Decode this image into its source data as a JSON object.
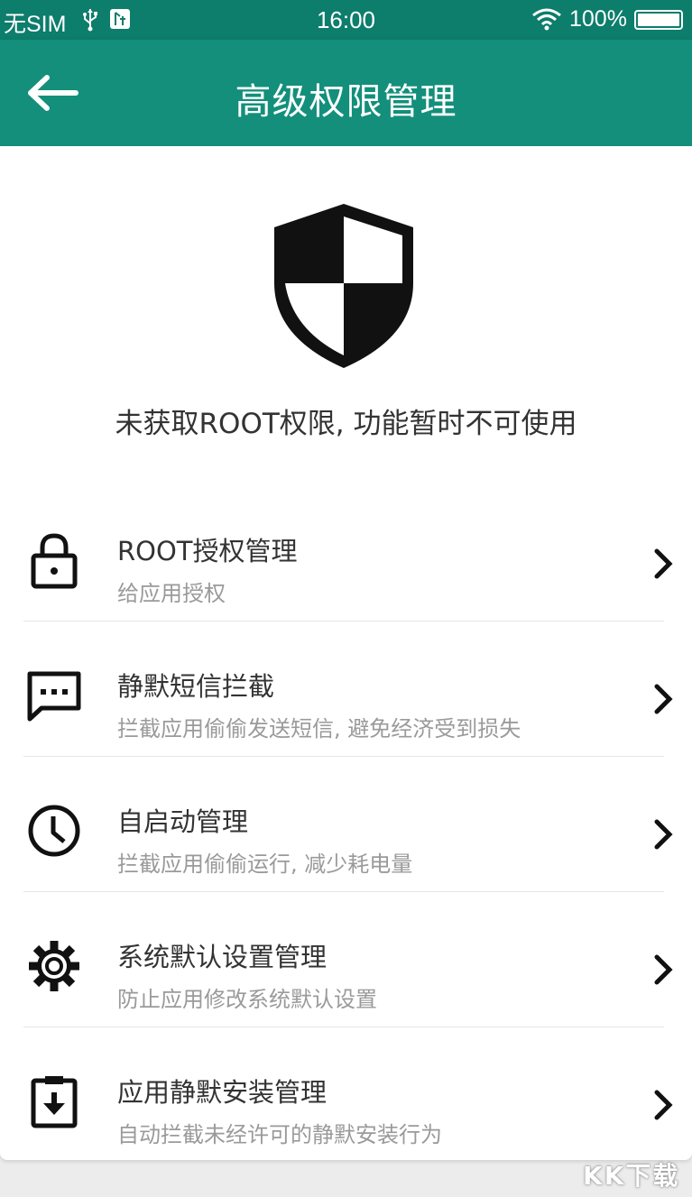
{
  "status_bar": {
    "carrier": "无SIM",
    "time": "16:00",
    "battery": "100%"
  },
  "app_bar": {
    "title": "高级权限管理",
    "back_icon": "arrow-left-icon"
  },
  "notice": {
    "icon": "shield-icon",
    "text": "未获取ROOT权限, 功能暂时不可使用"
  },
  "menu": {
    "items": [
      {
        "icon": "lock-icon",
        "title": "ROOT授权管理",
        "subtitle": "给应用授权"
      },
      {
        "icon": "message-dots-icon",
        "title": "静默短信拦截",
        "subtitle": "拦截应用偷偷发送短信, 避免经济受到损失"
      },
      {
        "icon": "clock-icon",
        "title": "自启动管理",
        "subtitle": "拦截应用偷偷运行, 减少耗电量"
      },
      {
        "icon": "gear-icon",
        "title": "系统默认设置管理",
        "subtitle": "防止应用修改系统默认设置"
      },
      {
        "icon": "install-download-icon",
        "title": "应用静默安装管理",
        "subtitle": "自动拦截未经许可的静默安装行为"
      }
    ]
  },
  "watermark": "KK下载",
  "colors": {
    "status_bar": "#0d7d6c",
    "app_bar": "#138f7b",
    "title_text": "#333333",
    "subtitle_text": "#9a9a9a",
    "icon": "#111111"
  }
}
